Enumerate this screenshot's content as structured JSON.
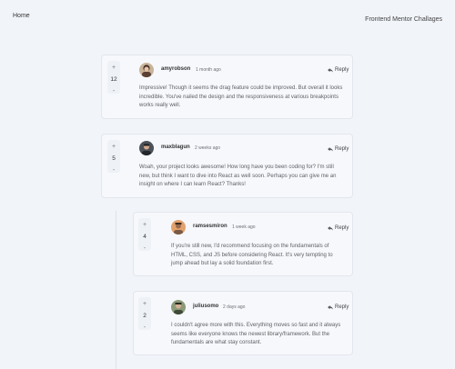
{
  "nav": {
    "home_label": "Home",
    "right_label": "Frontend Mentor Challages"
  },
  "colors": {
    "background": "#f1f4f9",
    "card": "#f6f8fc",
    "border": "#e3e6ec"
  },
  "comments": [
    {
      "score": "12",
      "username": "amyrobson",
      "time": "1 month ago",
      "reply_label": "Reply",
      "content": "Impressive! Though it seems the drag feature could be improved. But overall it looks incredible. You've nailed the design and the responsiveness at various breakpoints works really well.",
      "avatar_icon": "avatar-amyrobson"
    },
    {
      "score": "5",
      "username": "maxblagun",
      "time": "2 weeks ago",
      "reply_label": "Reply",
      "content": "Woah, your project looks awesome! How long have you been coding for? I'm still new, but think I want to dive into React as well soon. Perhaps you can give me an insight on where I can learn React? Thanks!",
      "avatar_icon": "avatar-maxblagun"
    }
  ],
  "replies": [
    {
      "score": "4",
      "username": "ramsesmiron",
      "time": "1 week ago",
      "reply_label": "Reply",
      "content": "If you're still new, I'd recommend focusing on the fundamentals of HTML, CSS, and JS before considering React. It's very tempting to jump ahead but lay a solid foundation first.",
      "avatar_icon": "avatar-ramsesmiron"
    },
    {
      "score": "2",
      "username": "juliusomo",
      "time": "2 days ago",
      "reply_label": "Reply",
      "content": "I couldn't agree more with this. Everything moves so fast and it always seems like everyone knows the newest library/framework. But the fundamentals are what stay constant.",
      "avatar_icon": "avatar-juliusomo"
    }
  ],
  "vote": {
    "plus": "+",
    "minus": "-"
  }
}
